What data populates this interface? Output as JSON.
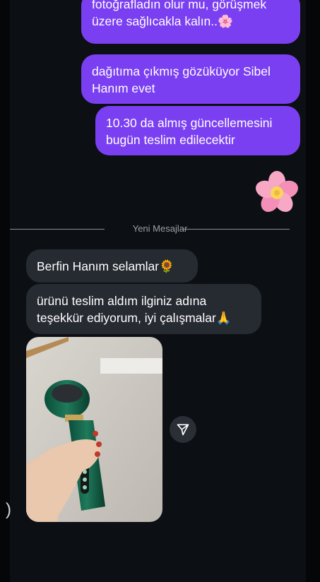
{
  "messages_out": [
    {
      "text_line1": "fotoğrafladın olur mu, görüşmek",
      "text_line2": "üzere sağlıcakla kalın..",
      "emoji": "🌸"
    },
    {
      "text_line1": "dağıtıma çıkmış gözüküyor Sibel",
      "text_line2": "Hanım evet"
    },
    {
      "text_line1": "10.30 da almış güncellemesini",
      "text_line2": "bugün teslim edilecektir"
    }
  ],
  "sticker_out": {
    "emoji": "🌸"
  },
  "divider": {
    "label": "Yeni Mesajlar"
  },
  "messages_in": [
    {
      "text": "Berfin Hanım selamlar",
      "emoji": "🌻"
    },
    {
      "text_line1": "ürünü teslim aldım ilginiz adına",
      "text_line2": "teşekkür ediyorum, iyi çalışmalar",
      "emoji": "🙏"
    }
  ],
  "photo_message": {
    "icon": "handheld-device-photo"
  },
  "share_button": {
    "icon": "paper-plane-icon"
  },
  "colors": {
    "background": "#0c0f14",
    "outgoing_bubble": "#7b3ff2",
    "incoming_bubble": "#262a31"
  }
}
